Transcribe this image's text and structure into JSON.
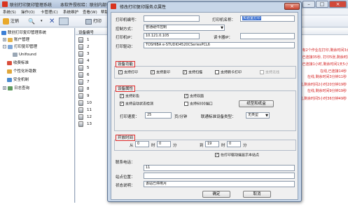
{
  "window": {
    "title": "联创打印复印管理系统　　本软件授权给：联创内部使用"
  },
  "menubar": [
    "系统(S)",
    "操作(O)",
    "卡管理(C)",
    "系统维护",
    "查看(W)",
    "帮助(H)"
  ],
  "toolbar": {
    "login": "注销",
    "search_sym": "🔍",
    "printer_btn": "打印"
  },
  "tree": {
    "root": "联创打印复印管理系统",
    "items": [
      "账户管理",
      "打印复印管理",
      "Unifound",
      "收费标准",
      "个性化补助数",
      "安全机制",
      "日志查询"
    ]
  },
  "grid": {
    "col1": "设备编号",
    "rows": [
      "1",
      "2",
      "3",
      "4",
      "5",
      "6",
      "7",
      "8",
      "9",
      "10",
      "11",
      "12",
      "13"
    ],
    "right_notes": [
      "在线,有2个作业在打印,剩余时间3点28秒",
      "在线,已连接35秒, 打印5张,剩余时间20天1小时7分钟36秒",
      "在线,已连接1小时,剩余时间1天5小时20分钟",
      "在线,已连接14秒",
      "在线,剩余时间3分钟11秒",
      "在线,剩余时间2小时20分钟19秒",
      "在线,剩余时间9分钟19秒",
      "在线,剩余时间5小时36分钟49秒"
    ]
  },
  "dialog": {
    "title": "修改打印复印服务点属性",
    "close": "×",
    "printer_no_label": "打印机编号：",
    "printer_no": "",
    "printer_name_label": "打印机名称：",
    "printer_name": "实验室打印",
    "control_mode_label": "控制方式：",
    "control_mode": "普通硬件控制",
    "printer_ip_label": "打印机IP：",
    "printer_ip": "10.121.0.105",
    "card_reader_ip_label": "读卡器IP：",
    "card_reader_ip": "",
    "driver_label": "打印驱动：",
    "driver": "TOSHIBA e-STUDIO4520CSeriesPCL6",
    "device_func_title": "设备功能",
    "func_print": "支持打印",
    "func_copy": "支持复印",
    "func_scan": "支持扫描",
    "func_nocard": "支持刷卡打印",
    "func_other": "支持无线",
    "device_attr_title": "设备属性",
    "attr_color": "支持彩色",
    "attr_duplex": "支持双面",
    "attr_autodetect": "支持自动状态检测",
    "attr_a3": "支持6000端口",
    "paper_btn": "纸型和纸盒",
    "print_speed_label": "打印速度：",
    "print_speed": "25",
    "speed_unit": "页/分钟",
    "auth_label": "联通标准设备类型：",
    "auth_type": "无类型",
    "open_time_title": "开放时间",
    "from_label": "从",
    "from_h": "0",
    "from_m": "0",
    "to_label": "到",
    "to_h": "19",
    "to_m": "0",
    "hour_unit": "时",
    "min_unit": "分",
    "show_on_hover": "在打印驱动端显示本站点",
    "contact_label": "联系电话：",
    "contact": "11",
    "location_label": "站点位置：",
    "location": "",
    "status_label": "状态说明：",
    "status": "该站已停用月",
    "ok": "确定",
    "cancel": "取消"
  },
  "colors": {
    "title_red": "#e02a2a",
    "note_red": "#d42020"
  }
}
